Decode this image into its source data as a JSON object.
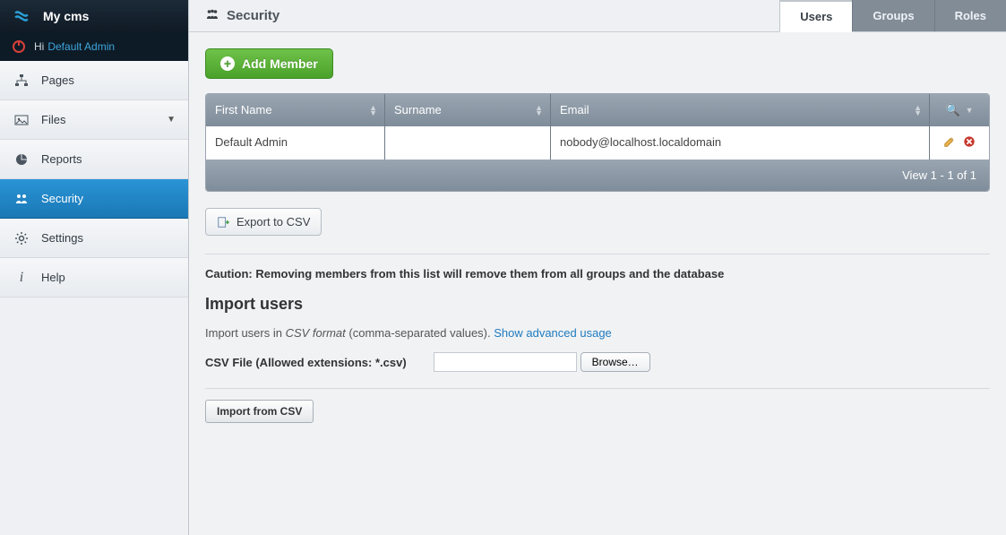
{
  "brand": {
    "title": "My cms"
  },
  "greeting": {
    "hi": "Hi",
    "user": "Default Admin"
  },
  "nav": {
    "pages": "Pages",
    "files": "Files",
    "reports": "Reports",
    "security": "Security",
    "settings": "Settings",
    "help": "Help"
  },
  "page": {
    "title": "Security"
  },
  "tabs": {
    "users": "Users",
    "groups": "Groups",
    "roles": "Roles"
  },
  "buttons": {
    "add_member": "Add Member",
    "export_csv": "Export to CSV",
    "browse": "Browse…",
    "import_csv": "Import from CSV"
  },
  "grid": {
    "headers": {
      "first_name": "First Name",
      "surname": "Surname",
      "email": "Email"
    },
    "rows": [
      {
        "first_name": "Default Admin",
        "surname": "",
        "email": "nobody@localhost.localdomain"
      }
    ],
    "footer": "View 1 - 1 of 1"
  },
  "caution": "Caution: Removing members from this list will remove them from all groups and the database",
  "import": {
    "heading": "Import users",
    "desc_pre": "Import users in ",
    "desc_em": "CSV format",
    "desc_post": " (comma-separated values). ",
    "link": "Show advanced usage",
    "file_label": "CSV File (Allowed extensions: *.csv)"
  }
}
